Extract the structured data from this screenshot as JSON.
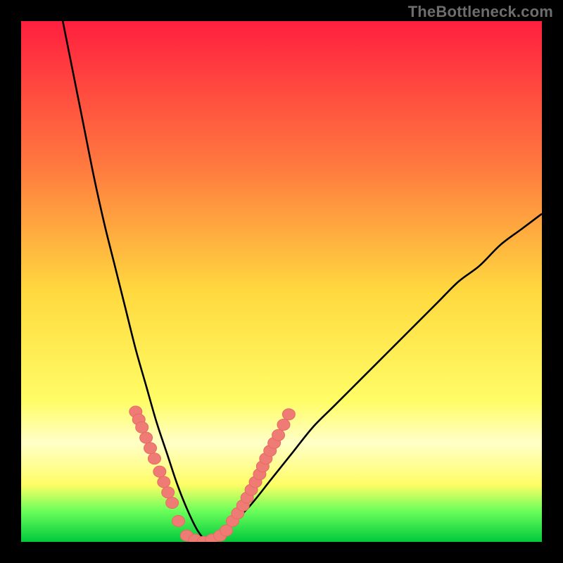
{
  "watermark": "TheBottleneck.com",
  "colors": {
    "gradient_top": "#ff1f3f",
    "gradient_mid_upper": "#ff7a3f",
    "gradient_mid": "#ffd93f",
    "gradient_lower_yellow": "#fffd66",
    "gradient_paleband": "#ffffc8",
    "gradient_green_mid": "#6cff5a",
    "gradient_green_bottom": "#00c93c",
    "curve_stroke": "#000000",
    "marker_fill": "#ef7b75",
    "marker_stroke": "#e96a64",
    "frame": "#000000"
  },
  "chart_data": {
    "type": "line",
    "title": "",
    "subtitle": "",
    "xlabel": "",
    "ylabel": "",
    "xlim": [
      0,
      100
    ],
    "ylim": [
      0,
      100
    ],
    "grid": false,
    "legend": false,
    "annotations": [],
    "notes": "V-shaped bottleneck curve; minimum ≈0 around x≈30–36; left branch rises to ~100 at x≈8; right branch rises to ~63 at x=100. Pink bead markers appear near low values on both branches.",
    "series": [
      {
        "name": "bottleneck_curve",
        "x": [
          8,
          10,
          12,
          14,
          16,
          18,
          20,
          22,
          24,
          26,
          28,
          30,
          32,
          34,
          36,
          38,
          40,
          44,
          48,
          52,
          56,
          60,
          64,
          68,
          72,
          76,
          80,
          84,
          88,
          92,
          96,
          100
        ],
        "y": [
          100,
          90,
          80,
          70,
          61,
          53,
          45,
          37,
          30,
          23,
          17,
          11,
          6,
          2,
          0,
          1,
          3,
          7,
          12,
          17,
          22,
          26,
          30,
          34,
          38,
          42,
          46,
          50,
          53,
          57,
          60,
          63
        ]
      },
      {
        "name": "markers_left_branch",
        "x": [
          22.0,
          22.6,
          23.2,
          24.0,
          24.8,
          25.6,
          26.6,
          27.4,
          28.2,
          29.0,
          30.2
        ],
        "y": [
          25.0,
          23.5,
          22.0,
          20.0,
          18.0,
          16.0,
          13.5,
          11.5,
          9.5,
          7.5,
          4.0
        ]
      },
      {
        "name": "markers_bottom",
        "x": [
          31.8,
          33.4,
          35.0,
          36.6,
          38.2,
          39.4
        ],
        "y": [
          1.2,
          0.4,
          0.0,
          0.4,
          1.2,
          2.2
        ]
      },
      {
        "name": "markers_right_branch",
        "x": [
          40.6,
          41.6,
          42.6,
          43.4,
          44.2,
          45.0,
          45.8,
          46.4,
          47.0,
          47.8,
          48.6,
          49.4,
          50.4,
          51.4
        ],
        "y": [
          4.0,
          5.5,
          7.0,
          8.5,
          10.0,
          11.5,
          13.0,
          14.5,
          16.0,
          17.5,
          19.0,
          20.5,
          22.5,
          24.5
        ]
      }
    ]
  }
}
